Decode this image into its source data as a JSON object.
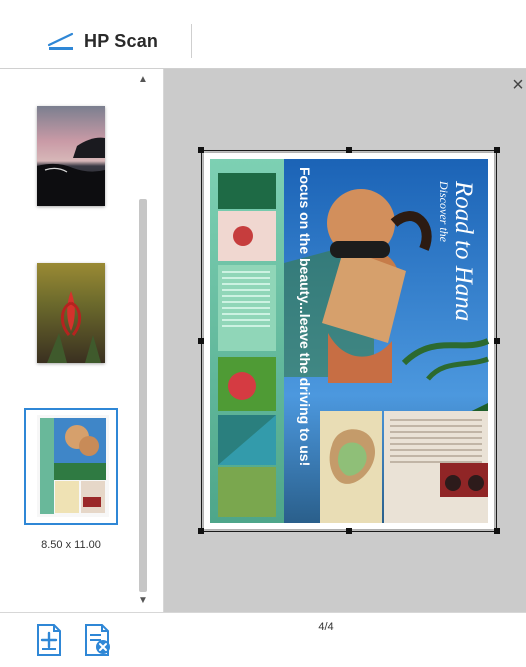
{
  "app": {
    "title": "HP Scan",
    "icon": "hp-scan-icon",
    "accent_color": "#2f87d6"
  },
  "header": {
    "title": "HP Scan"
  },
  "thumbnails": {
    "items": [
      {
        "label": "",
        "icon": "photo-thumbnail-seascape"
      },
      {
        "label": "",
        "icon": "photo-thumbnail-flower"
      },
      {
        "label": "8.50 x 11.00",
        "icon": "photo-thumbnail-magazine",
        "selected": true
      }
    ],
    "scroll_up_icon": "chevron-up-icon",
    "scroll_down_icon": "chevron-down-icon"
  },
  "preview": {
    "close_icon": "close-icon",
    "page_text": {
      "headline": "Focus on the beauty...leave the driving to us!",
      "title": "Road to Hana",
      "kicker": "Discover the"
    }
  },
  "footer": {
    "page_counter": "4/4",
    "buttons": [
      {
        "name": "add-page-button",
        "icon": "add-page-icon"
      },
      {
        "name": "delete-page-button",
        "icon": "delete-page-icon"
      }
    ]
  }
}
